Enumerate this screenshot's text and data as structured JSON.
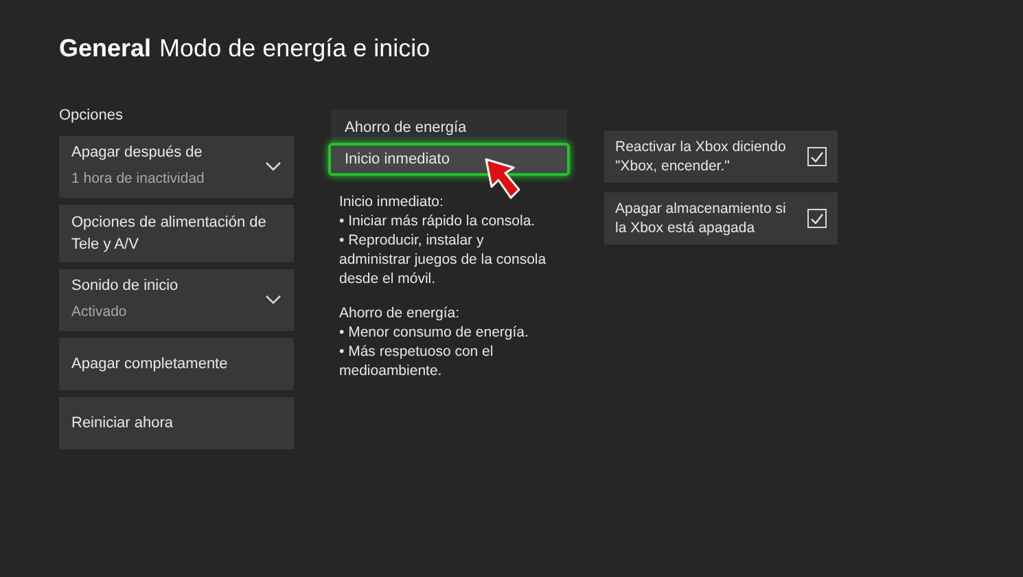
{
  "header": {
    "section": "General",
    "title": "Modo de energía e inicio"
  },
  "options": {
    "label": "Opciones",
    "items": [
      {
        "kind": "dropdown",
        "label": "Apagar después de",
        "value": "1 hora de inactividad"
      },
      {
        "kind": "button",
        "label": "Opciones de alimentación de Tele y A/V"
      },
      {
        "kind": "dropdown",
        "label": "Sonido de inicio",
        "value": "Activado"
      },
      {
        "kind": "button",
        "label": "Apagar completamente"
      },
      {
        "kind": "button",
        "label": "Reiniciar ahora"
      }
    ]
  },
  "power_modes": [
    {
      "label": "Ahorro de energía",
      "selected": false
    },
    {
      "label": "Inicio inmediato",
      "selected": true
    }
  ],
  "description": [
    {
      "heading": "Inicio inmediato:",
      "bullets": [
        "• Iniciar más rápido la consola.",
        "• Reproducir, instalar y administrar juegos de la consola desde el móvil."
      ]
    },
    {
      "heading": "Ahorro de energía:",
      "bullets": [
        "• Menor consumo de energía.",
        "• Más respetuoso con el medioambiente."
      ]
    }
  ],
  "toggles": [
    {
      "label": "Reactivar la Xbox diciendo \"Xbox, encender.\"",
      "checked": true
    },
    {
      "label": "Apagar almacenamiento si la Xbox está apagada",
      "checked": true
    }
  ]
}
